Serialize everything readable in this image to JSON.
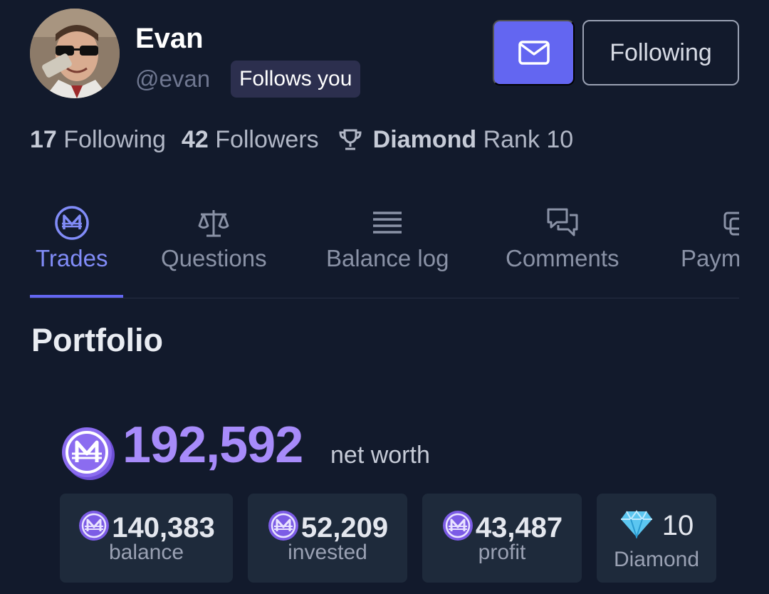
{
  "profile": {
    "name": "Evan",
    "handle": "@evan",
    "follows_you": "Follows you",
    "following_button": "Following"
  },
  "stats": {
    "following_count": "17",
    "following_label": "Following",
    "followers_count": "42",
    "followers_label": "Followers",
    "rank_tier": "Diamond",
    "rank_label": "Rank 10"
  },
  "tabs": [
    {
      "label": "Trades",
      "icon": "mana-coin-icon",
      "active": true
    },
    {
      "label": "Questions",
      "icon": "scale-icon",
      "active": false
    },
    {
      "label": "Balance log",
      "icon": "list-icon",
      "active": false
    },
    {
      "label": "Comments",
      "icon": "chat-bubbles-icon",
      "active": false
    },
    {
      "label": "Payments",
      "icon": "payments-icon",
      "active": false
    }
  ],
  "portfolio": {
    "title": "Portfolio",
    "net_worth": "192,592",
    "net_worth_label": "net worth",
    "cards": [
      {
        "value": "140,383",
        "label": "balance"
      },
      {
        "value": "52,209",
        "label": "invested"
      },
      {
        "value": "43,487",
        "label": "profit"
      },
      {
        "value": "10",
        "label": "Diamond"
      }
    ]
  },
  "colors": {
    "background": "#121a2c",
    "accent": "#6366f1",
    "accent_text": "#818cf8",
    "net_worth": "#a78bfa",
    "card_bg": "#1e2a3b"
  }
}
